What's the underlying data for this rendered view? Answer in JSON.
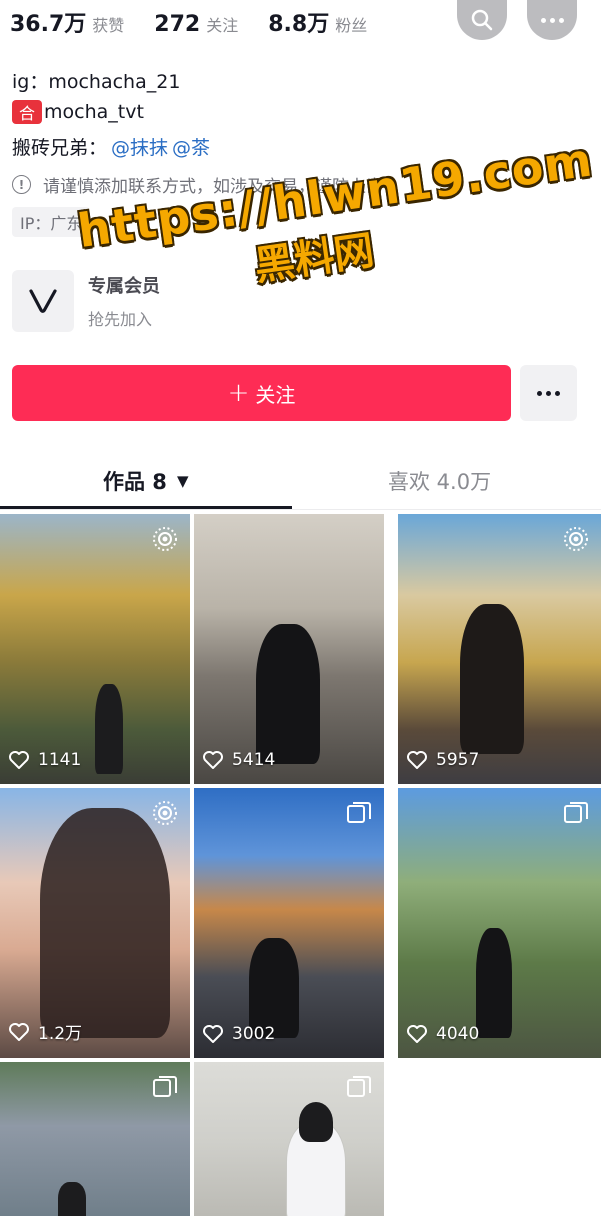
{
  "stats": [
    {
      "num": "36.7万",
      "label": "获赞"
    },
    {
      "num": "272",
      "label": "关注"
    },
    {
      "num": "8.8万",
      "label": "粉丝"
    }
  ],
  "bio": {
    "ig": "ig：mochacha_21",
    "xhs_badge": "合",
    "xhs": "mocha_tvt",
    "bro_label": "搬砖兄弟：",
    "mention_1": "@抹抹",
    "mention_2": "@茶",
    "warning": "请谨慎添加联系方式，如涉及交易，谨防上当",
    "warning_icon_glyph": "!",
    "ip": "IP：广东"
  },
  "member": {
    "title": "专属会员",
    "subtitle": "抢先加入"
  },
  "watermark": {
    "url": "https://hlwn19.com",
    "name": "黑料网"
  },
  "actions": {
    "follow_plus": "+",
    "follow_label": "关注"
  },
  "tabs": {
    "works_label": "作品 8",
    "works_caret": "▼",
    "likes_label": "喜欢 4.0万"
  },
  "videos": [
    {
      "likes": "1141",
      "type_icon": "live-photo-icon"
    },
    {
      "likes": "5414",
      "type_icon": "none"
    },
    {
      "likes": "5957",
      "type_icon": "live-photo-icon"
    },
    {
      "likes": "1.2万",
      "type_icon": "live-photo-icon"
    },
    {
      "likes": "3002",
      "type_icon": "image-stack-icon"
    },
    {
      "likes": "4040",
      "type_icon": "image-stack-icon"
    },
    {
      "likes": "",
      "type_icon": "image-stack-icon"
    },
    {
      "likes": "",
      "type_icon": "image-stack-icon"
    }
  ],
  "colors": {
    "follow_button": "#fe2c55",
    "mention": "#2b6ec4",
    "watermark": "#f5a800"
  }
}
